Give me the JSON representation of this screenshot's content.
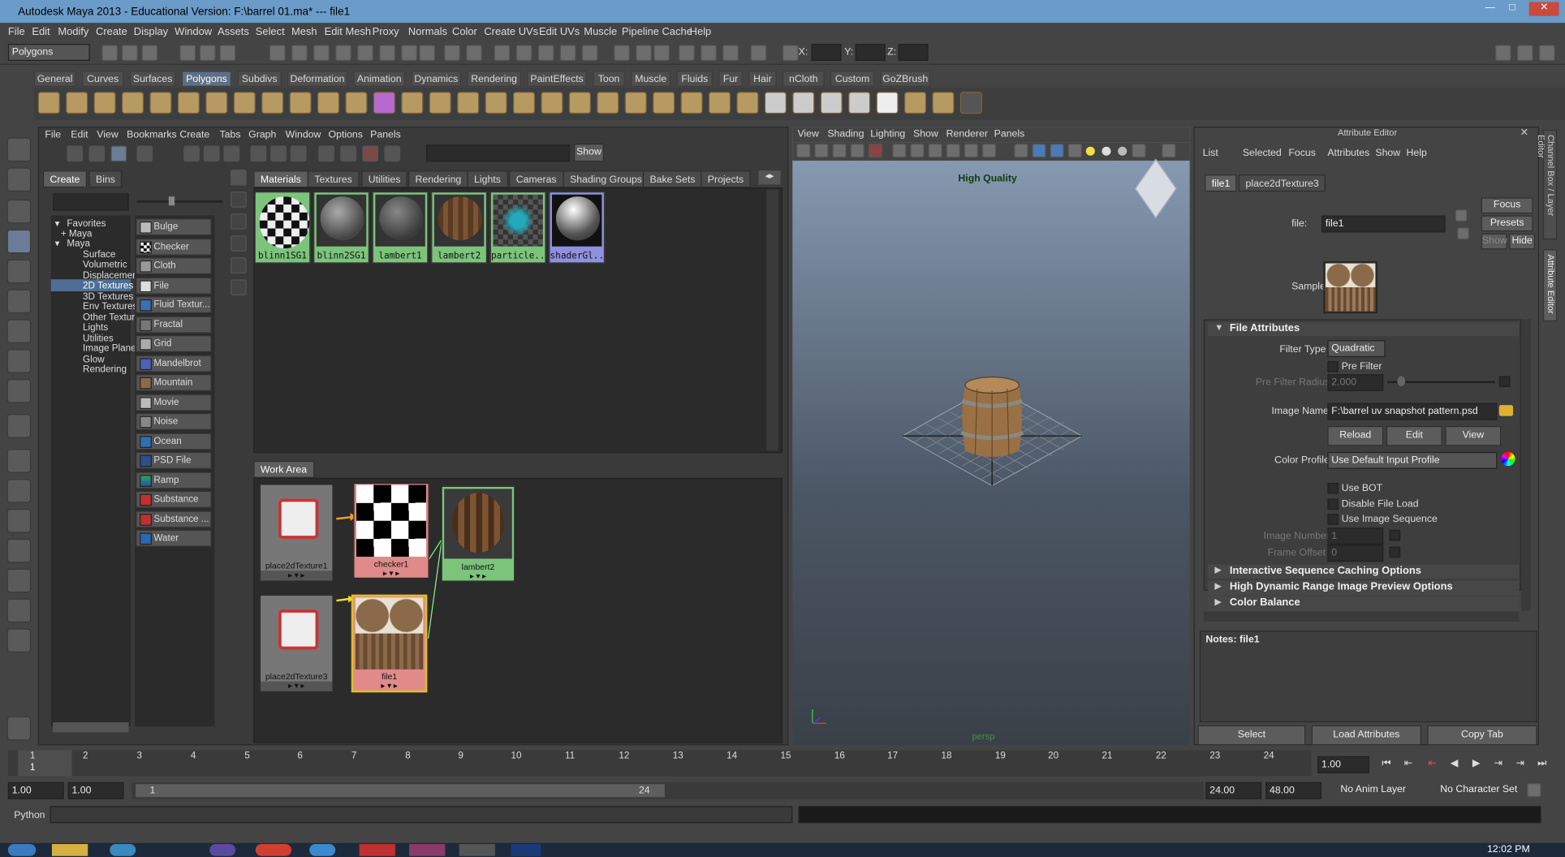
{
  "window": {
    "title": "Autodesk Maya 2013 - Educational Version: F:\\barrel 01.ma*   ---   file1",
    "min": "—",
    "max": "□",
    "close": "✕"
  },
  "menubar": [
    "File",
    "Edit",
    "Modify",
    "Create",
    "Display",
    "Window",
    "Assets",
    "Select",
    "Mesh",
    "Edit Mesh",
    "Proxy",
    "Normals",
    "Color",
    "Create UVs",
    "Edit UVs",
    "Muscle",
    "Pipeline Cache",
    "Help"
  ],
  "status": {
    "mode": "Polygons",
    "x_label": "X:",
    "y_label": "Y:",
    "z_label": "Z:"
  },
  "shelf_tabs": [
    "General",
    "Curves",
    "Surfaces",
    "Polygons",
    "Subdivs",
    "Deformation",
    "Animation",
    "Dynamics",
    "Rendering",
    "PaintEffects",
    "Toon",
    "Muscle",
    "Fluids",
    "Fur",
    "Hair",
    "nCloth",
    "Custom",
    "GoZBrush"
  ],
  "shelf_active": "Polygons",
  "hypershade": {
    "menu": [
      "File",
      "Edit",
      "View",
      "Bookmarks",
      "Create",
      "Tabs",
      "Graph",
      "Window",
      "Options",
      "Panels"
    ],
    "show_button": "Show",
    "create_tabs": [
      "Create",
      "Bins"
    ],
    "tree": [
      "Favorites",
      "Maya",
      "Maya",
      "Surface",
      "Volumetric",
      "Displacement",
      "2D Textures",
      "3D Textures",
      "Env Textures",
      "Other Textures",
      "Lights",
      "Utilities",
      "Image Planes",
      "Glow",
      "Rendering"
    ],
    "tree_selected": "2D Textures",
    "node_buttons": [
      "Bulge",
      "Checker",
      "Cloth",
      "File",
      "Fluid Textur...",
      "Fractal",
      "Grid",
      "Mandelbrot",
      "Mountain",
      "Movie",
      "Noise",
      "Ocean",
      "PSD File",
      "Ramp",
      "Substance",
      "Substance ...",
      "Water"
    ],
    "tabs": [
      "Materials",
      "Textures",
      "Utilities",
      "Rendering",
      "Lights",
      "Cameras",
      "Shading Groups",
      "Bake Sets",
      "Projects"
    ],
    "materials": [
      "blinn1SG1",
      "blinn2SG1",
      "lambert1",
      "lambert2",
      "particle...",
      "shaderGl..."
    ],
    "work_area_tab": "Work Area",
    "nodes": {
      "p2d1": "place2dTexture1",
      "checker": "checker1",
      "lambert": "lambert2",
      "p2d3": "place2dTexture3",
      "file": "file1"
    }
  },
  "viewport": {
    "menu": [
      "View",
      "Shading",
      "Lighting",
      "Show",
      "Renderer",
      "Panels"
    ],
    "quality": "High Quality",
    "camera": "persp"
  },
  "attr": {
    "title": "Attribute Editor",
    "menu": [
      "List",
      "Selected",
      "Focus",
      "Attributes",
      "Show",
      "Help"
    ],
    "tabs": [
      "file1",
      "place2dTexture3"
    ],
    "file_label": "file:",
    "file_value": "file1",
    "focus": "Focus",
    "presets": "Presets",
    "show": "Show",
    "hide": "Hide",
    "sample": "Sample",
    "sec_file": "File Attributes",
    "filter_type_label": "Filter Type",
    "filter_type": "Quadratic",
    "pre_filter": "Pre Filter",
    "pre_filter_radius_label": "Pre Filter Radius",
    "pre_filter_radius": "2.000",
    "image_name_label": "Image Name",
    "image_name": "F:\\barrel uv snapshot pattern.psd",
    "reload": "Reload",
    "edit": "Edit",
    "view": "View",
    "color_profile_label": "Color Profile",
    "color_profile": "Use Default Input Profile",
    "use_bot": "Use BOT",
    "disable_file_load": "Disable File Load",
    "use_image_sequence": "Use Image Sequence",
    "image_number_label": "Image Number",
    "image_number": "1",
    "frame_offset_label": "Frame Offset",
    "frame_offset": "0",
    "sec_isc": "Interactive Sequence Caching Options",
    "sec_hdr": "High Dynamic Range Image Preview Options",
    "sec_cb": "Color Balance",
    "notes": "Notes:  file1",
    "select": "Select",
    "load_attributes": "Load Attributes",
    "copy_tab": "Copy Tab"
  },
  "timeline": {
    "ticks": [
      "1",
      "2",
      "3",
      "4",
      "5",
      "6",
      "7",
      "8",
      "9",
      "10",
      "11",
      "12",
      "13",
      "14",
      "15",
      "16",
      "17",
      "18",
      "19",
      "20",
      "21",
      "22",
      "23",
      "24"
    ],
    "current": "1",
    "frame_field": "1.00"
  },
  "range": {
    "start": "1.00",
    "start2": "1.00",
    "slider_start": "1",
    "slider_end": "24",
    "end": "24.00",
    "end2": "48.00",
    "anim_layer": "No Anim Layer",
    "char_set": "No Character Set"
  },
  "cmdline": {
    "label": "Python"
  },
  "taskbar": {
    "clock": "12:02 PM"
  },
  "colors": {
    "title_bg": "#6b9bc8",
    "accent_sel": "#5c6f86",
    "mat_green": "#7cc47c",
    "node_red": "#e08a8a"
  }
}
